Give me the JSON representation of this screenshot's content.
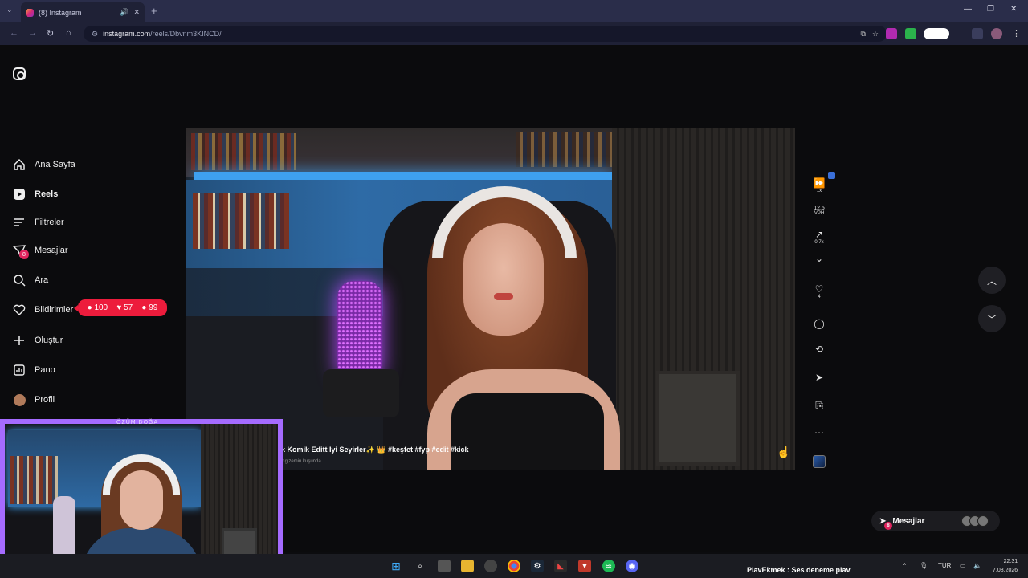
{
  "browser": {
    "tab_title": "(8) Instagram",
    "url_host": "instagram.com",
    "url_path": "/reels/Dbvnm3KINCD/",
    "new_tab_label": "+"
  },
  "sidebar": {
    "items": [
      {
        "label": "Ana Sayfa",
        "icon": "home-icon"
      },
      {
        "label": "Reels",
        "icon": "reels-icon"
      },
      {
        "label": "Filtreler",
        "icon": "filter-icon"
      },
      {
        "label": "Mesajlar",
        "icon": "messages-icon",
        "badge": "8"
      },
      {
        "label": "Ara",
        "icon": "search-icon"
      },
      {
        "label": "Bildirimler",
        "icon": "heart-icon"
      },
      {
        "label": "Oluştur",
        "icon": "plus-icon"
      },
      {
        "label": "Pano",
        "icon": "dashboard-icon"
      },
      {
        "label": "Profil",
        "icon": "avatar-icon"
      }
    ]
  },
  "notifications": {
    "comments": "100",
    "likes": "57",
    "followers": "99"
  },
  "reel": {
    "caption": "k Komik Editt İyi Seyirler✨ 👑 #keşfet #fyp #edit #kick",
    "caption_sub": "k gizemin kuşunda",
    "speed_label": "1x",
    "vph_value": "12.5",
    "vph_unit": "VPH",
    "trend_value": "0.7x",
    "like_count": "4"
  },
  "messages_pill": {
    "label": "Mesajlar",
    "badge": "8"
  },
  "webcam": {
    "title": "ÖZÜM DOĞA"
  },
  "taskbar": {
    "now_playing": "PlavEkmek : Ses deneme plav",
    "lang": "TUR",
    "time": "22:31",
    "date": "7.08.2026"
  },
  "colors": {
    "accent": "#a56bff",
    "notif": "#ed1c3c",
    "chrome": "#2a2d4a"
  }
}
